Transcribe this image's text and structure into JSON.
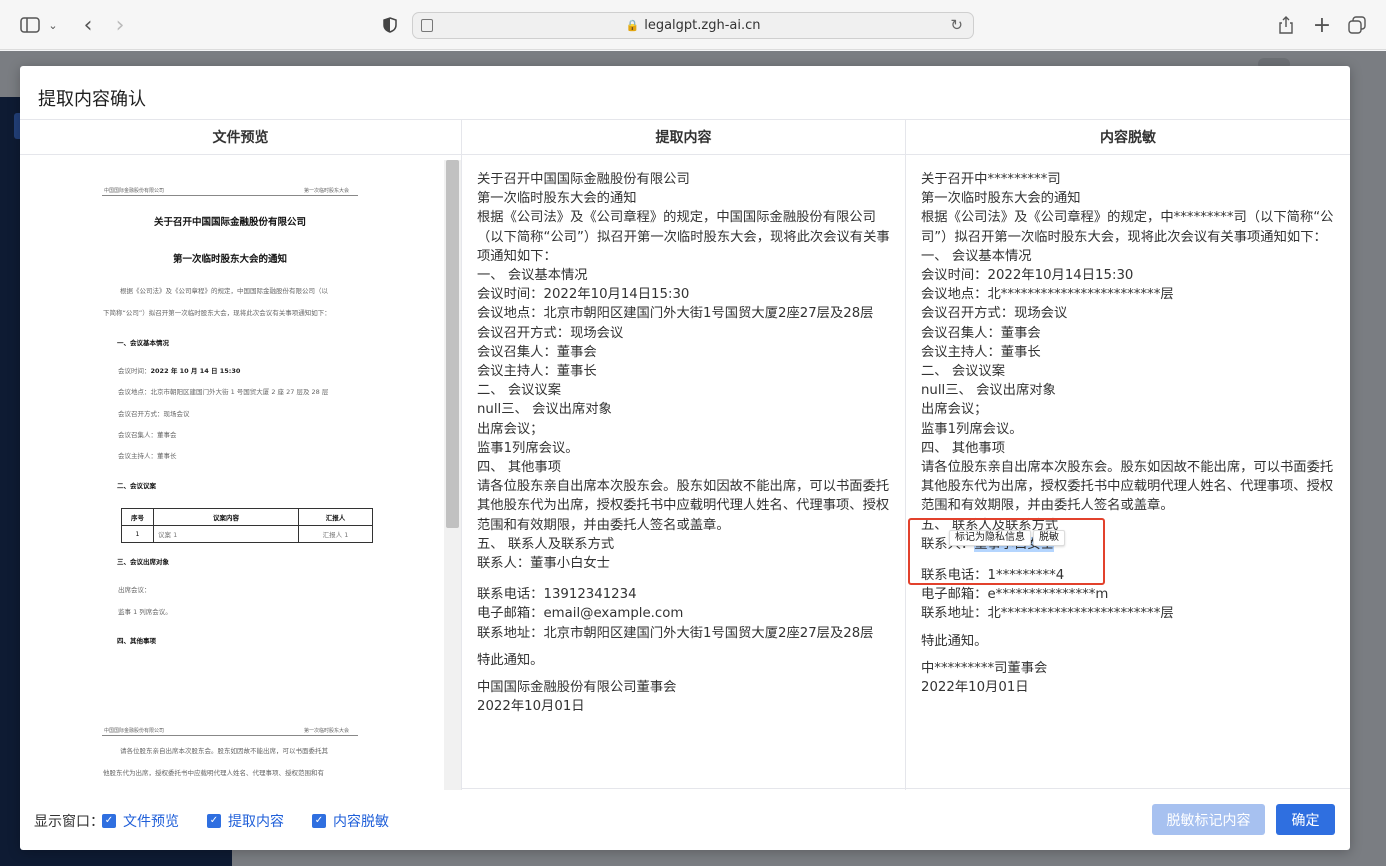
{
  "browser": {
    "url": "legalgpt.zgh-ai.cn"
  },
  "modal": {
    "title": "提取内容确认",
    "columns": [
      "文件预览",
      "提取内容",
      "内容脱敏"
    ]
  },
  "preview": {
    "header_left": "中国国际金融股份有限公司",
    "header_right": "第一次临时股东大会",
    "title1": "关于召开中国国际金融股份有限公司",
    "title2": "第一次临时股东大会的通知",
    "para1": "根据《公司法》及《公司章程》的规定，中国国际金融股份有限公司（以",
    "para2": "下简称“公司”）拟召开第一次临时股东大会，现将此次会议有关事项通知如下：",
    "sec1": "一、会议基本情况",
    "time_label": "会议时间：",
    "time_value": "2022 年 10 月 14 日 15:30",
    "place": "会议地点：北京市朝阳区建国门外大街 1 号国贸大厦 2 座 27 层及 28 层",
    "method": "会议召开方式：现场会议",
    "convener": "会议召集人：董事会",
    "host": "会议主持人：董事长",
    "sec2": "二、会议议案",
    "table_headers": [
      "序号",
      "议案内容",
      "汇报人"
    ],
    "table_row": [
      "1",
      "议案 1",
      "汇报人 1"
    ],
    "sec3": "三、会议出席对象",
    "attend1": "出席会议：",
    "attend2": "监事 1 列席会议。",
    "sec4": "四、其他事项",
    "header2_left": "中国国际金融股份有限公司",
    "header2_right": "第一次临时股东大会",
    "p2_line1": "请各位股东亲自出席本次股东会。股东如因故不能出席，可以书面委托其",
    "p2_line2": "他股东代为出席，授权委托书中应载明代理人姓名、代理事项、授权范围和有"
  },
  "extracted": {
    "lines_a": [
      "关于召开中国国际金融股份有限公司",
      "第一次临时股东大会的通知",
      "根据《公司法》及《公司章程》的规定，中国国际金融股份有限公司（以下简称“公司”）拟召开第一次临时股东大会，现将此次会议有关事项通知如下：",
      "一、 会议基本情况",
      "会议时间：2022年10月14日15:30",
      "会议地点：北京市朝阳区建国门外大街1号国贸大厦2座27层及28层",
      "会议召开方式：现场会议",
      "会议召集人：董事会",
      "会议主持人：董事长",
      "二、 会议议案",
      "null三、 会议出席对象",
      "出席会议；",
      "监事1列席会议。",
      "四、 其他事项",
      "请各位股东亲自出席本次股东会。股东如因故不能出席，可以书面委托其他股东代为出席，授权委托书中应载明代理人姓名、代理事项、授权范围和有效期限，并由委托人签名或盖章。",
      "五、 联系人及联系方式",
      "联系人：董事小白女士"
    ],
    "lines_b": [
      "联系电话：13912341234",
      "电子邮箱：email@example.com",
      "联系地址：北京市朝阳区建国门外大街1号国贸大厦2座27层及28层"
    ],
    "notice": "特此通知。",
    "signer": "中国国际金融股份有限公司董事会",
    "date": "2022年10月01日"
  },
  "masked": {
    "lines_a": [
      "关于召开中*********司",
      "第一次临时股东大会的通知",
      "根据《公司法》及《公司章程》的规定，中*********司（以下简称“公司”）拟召开第一次临时股东大会，现将此次会议有关事项通知如下：",
      "一、 会议基本情况",
      "会议时间：2022年10月14日15:30",
      "会议地点：北************************层",
      "会议召开方式：现场会议",
      "会议召集人：董事会",
      "会议主持人：董事长",
      "二、 会议议案",
      "null三、 会议出席对象",
      "出席会议；",
      "监事1列席会议。",
      "四、 其他事项",
      "请各位股东亲自出席本次股东会。股东如因故不能出席，可以书面委托其他股东代为出席，授权委托书中应载明代理人姓名、代理事项、授权范围和有效期限，并由委托人签名或盖章。",
      "五、 联系人及联系方式"
    ],
    "contact_label": "联系人：",
    "contact_value": "董事小白女士",
    "lines_b": [
      "联系电话：1*********4",
      "电子邮箱：e***************m",
      "联系地址：北************************层"
    ],
    "notice": "特此通知。",
    "signer": "中*********司董事会",
    "date": "2022年10月01日",
    "popup_mark": "标记为隐私信息",
    "popup_mask": "脱敏"
  },
  "footer": {
    "label": "显示窗口：",
    "checkboxes": [
      "文件预览",
      "提取内容",
      "内容脱敏"
    ],
    "btn_mask": "脱敏标记内容",
    "btn_ok": "确定"
  },
  "colors": {
    "primary": "#2f6fe0",
    "highlight_box": "#e2412c",
    "selection": "#b4d5fe"
  }
}
